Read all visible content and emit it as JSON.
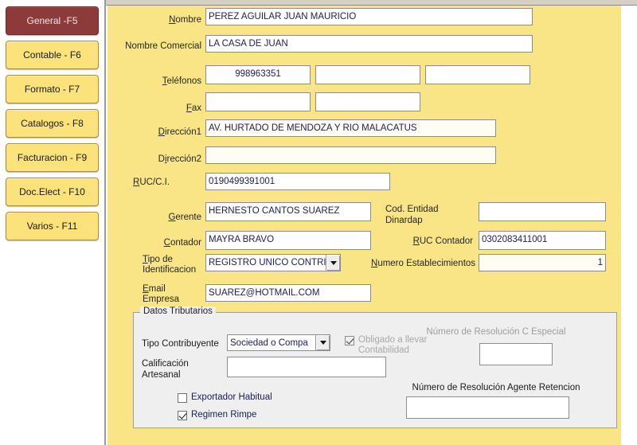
{
  "sidebar": {
    "items": [
      {
        "label": "General -F5",
        "active": true
      },
      {
        "label": "Contable - F6",
        "active": false
      },
      {
        "label": "Formato - F7",
        "active": false
      },
      {
        "label": "Catalogos - F8",
        "active": false
      },
      {
        "label": "Facturacion - F9",
        "active": false
      },
      {
        "label": "Doc.Elect - F10",
        "active": false
      },
      {
        "label": "Varios - F11",
        "active": false
      }
    ]
  },
  "form": {
    "nombre_label_pre": "",
    "nombre_label_key": "N",
    "nombre_label_post": "ombre",
    "nombre_value": "PEREZ AGUILAR JUAN MAURICIO",
    "nombre_comercial_label": "Nombre Comercial",
    "nombre_comercial_value": "LA CASA DE JUAN",
    "telefonos_label_key": "T",
    "telefonos_label_post": "eléfonos",
    "telefono1_value": "998963351",
    "telefono2_value": "",
    "telefono3_value": "",
    "fax_label_key": "F",
    "fax_label_post": "ax",
    "fax1_value": "",
    "fax2_value": "",
    "direccion1_label_key": "D",
    "direccion1_label_post": "irección1",
    "direccion1_value": "AV. HURTADO DE MENDOZA Y RIO MALACATUS",
    "direccion2_label_pre": "D",
    "direccion2_label_key": "i",
    "direccion2_label_post": "rección2",
    "direccion2_value": "",
    "ruc_label_key": "R",
    "ruc_label_post": "UC/C.I.",
    "ruc_value": "0190499391001",
    "gerente_label_key": "G",
    "gerente_label_post": "erente",
    "gerente_value": "HERNESTO CANTOS SUAREZ",
    "cod_entidad_line1": "Cod. Entidad",
    "cod_entidad_line2": "Dinardap",
    "cod_entidad_value": "",
    "contador_label_key": "C",
    "contador_label_post": "ontador",
    "contador_value": "MAYRA BRAVO",
    "ruc_contador_label_key": "R",
    "ruc_contador_label_post": "UC Contador",
    "ruc_contador_value": "0302083411001",
    "tipo_ident_label_key": "T",
    "tipo_ident_label_post": "ipo de",
    "tipo_ident_label_line2": "Identificacion",
    "tipo_ident_value": "REGISTRO UNICO CONTRIBU",
    "num_estab_label_key": "N",
    "num_estab_label_post": "umero Establecimientos",
    "num_estab_value": "1",
    "email_label_key": "E",
    "email_label_post": "mail",
    "email_label_line2": "Empresa",
    "email_value": "SUAREZ@HOTMAIL.COM"
  },
  "datos_tributarios": {
    "title": "Datos Tributarios",
    "tipo_contribuyente_label": "Tipo Contribuyente",
    "tipo_contribuyente_value": "Sociedad o Compa",
    "obligado_label_line1": "Obligado a llevar",
    "obligado_label_line2": "Contabilidad",
    "obligado_checked": true,
    "calificacion_label_line1": "Calificación",
    "calificacion_label_line2": "Artesanal",
    "calificacion_value": "",
    "num_resolucion_c_especial_label": "Número de Resolución C Especial",
    "num_resolucion_c_especial_value": "",
    "num_resolucion_agente_label": "Número de Resolución Agente Retencion",
    "num_resolucion_agente_value": "",
    "exportador_label": "Exportador Habitual",
    "exportador_checked": false,
    "rimpe_label": "Regimen Rimpe",
    "rimpe_checked": true
  },
  "colors": {
    "panel_bg": "#F9E585",
    "active_tab": "#8C3A3A",
    "tab_bg": "#FBE27A",
    "groupbox_bg": "#EFEFEF",
    "field_text": "#1C1C58"
  }
}
